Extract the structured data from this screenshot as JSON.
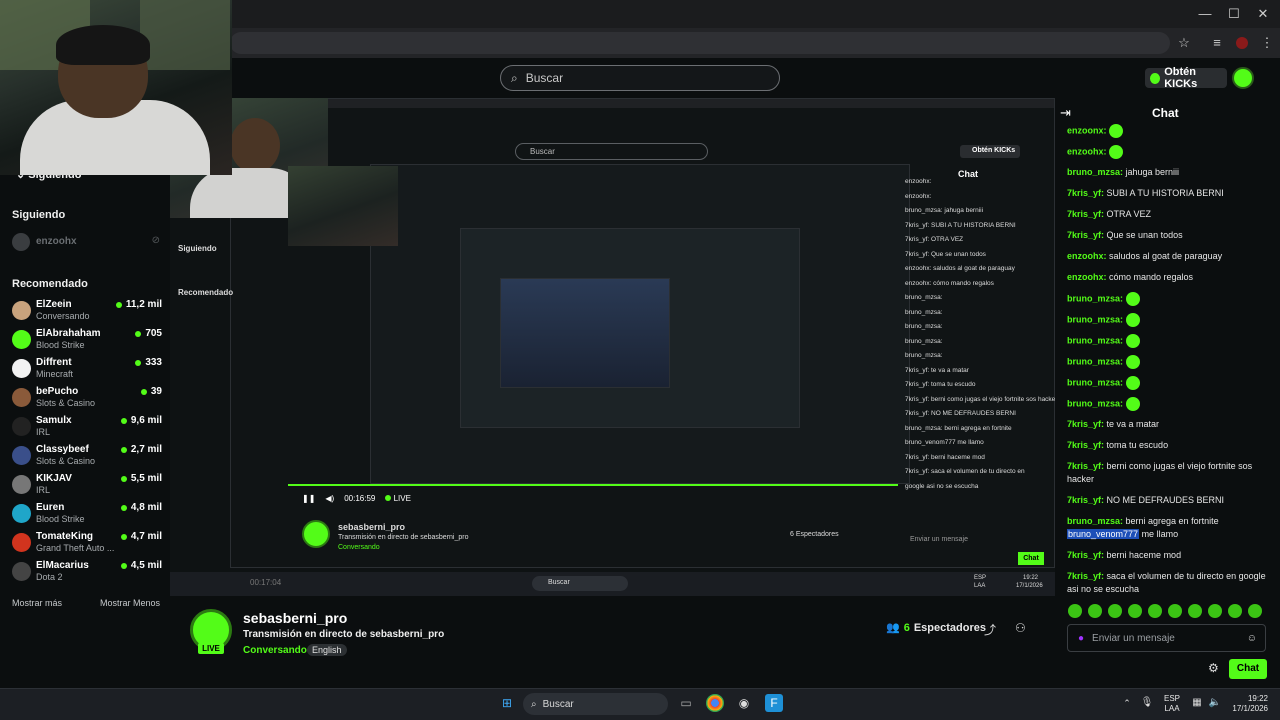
{
  "browser": {
    "window_controls": [
      "—",
      "☐",
      "✕"
    ],
    "toolbar_icons": [
      "star-icon",
      "reading-list-icon",
      "profile-icon",
      "menu-icon"
    ]
  },
  "header": {
    "search_placeholder": "Buscar",
    "kicks_label": "Obtén KICKs"
  },
  "sidebar": {
    "following_top": "Siguiendo",
    "following_label": "Siguiendo",
    "followed_channel": "enzoohx",
    "recommended_label": "Recomendado",
    "items": [
      {
        "name": "ElZeein",
        "category": "Conversando",
        "viewers": "11,2 mil",
        "color": "#c9a37d"
      },
      {
        "name": "ElAbrahaham",
        "category": "Blood Strike",
        "viewers": "705",
        "color": "#53fc18"
      },
      {
        "name": "Diffrent",
        "category": "Minecraft",
        "viewers": "333",
        "color": "#f2f2f2"
      },
      {
        "name": "bePucho",
        "category": "Slots & Casino",
        "viewers": "39",
        "color": "#8a5a3a"
      },
      {
        "name": "Samulx",
        "category": "IRL",
        "viewers": "9,6 mil",
        "color": "#222222"
      },
      {
        "name": "Classybeef",
        "category": "Slots & Casino",
        "viewers": "2,7 mil",
        "color": "#3a4f8a"
      },
      {
        "name": "KIKJAV",
        "category": "IRL",
        "viewers": "5,5 mil",
        "color": "#777777"
      },
      {
        "name": "Euren",
        "category": "Blood Strike",
        "viewers": "4,8 mil",
        "color": "#1fa6c9"
      },
      {
        "name": "TomateKing",
        "category": "Grand Theft Auto ...",
        "viewers": "4,7 mil",
        "color": "#d1341e"
      },
      {
        "name": "ElMacarius",
        "category": "Dota 2",
        "viewers": "4,5 mil",
        "color": "#444444"
      }
    ],
    "show_more": "Mostrar más",
    "show_less": "Mostrar Menos"
  },
  "player": {
    "time": "00:16:59",
    "live": "LIVE",
    "inner_channel": "sebasberni_pro",
    "inner_title": "Transmisión en directo de sebasberni_pro",
    "inner_category": "Conversando",
    "inner_language": "English",
    "inner_viewers": "6 Espectadores",
    "inner_chat_title": "Chat",
    "inner_chat_placeholder": "Enviar un mensaje",
    "inner_chat_button": "Chat",
    "inner_time_2": "00:17:04",
    "inner_taskbar_search": "Buscar",
    "inner_clock": "19:22",
    "inner_date": "17/1/2026",
    "inner_lang": "ESP",
    "inner_lang2": "LAA",
    "inner_chat_lines": [
      "enzoohx:",
      "enzoohx:",
      "bruno_mzsa: jahuga berniii",
      "7kris_yf: SUBI A TU HISTORIA BERNI",
      "7kris_yf: OTRA VEZ",
      "7kris_yf: Que se unan todos",
      "enzoohx: saludos al goat de paraguay",
      "enzoohx: cómo mando regalos",
      "bruno_mzsa:",
      "bruno_mzsa:",
      "bruno_mzsa:",
      "bruno_mzsa:",
      "bruno_mzsa:",
      "7kris_yf: te va a matar",
      "7kris_yf: toma tu escudo",
      "7kris_yf: berni como jugas el viejo fortnite sos hacker",
      "7kris_yf: NO ME DEFRAUDES BERNI",
      "bruno_mzsa: berni agrega en fortnite",
      "bruno_venom777 me llamo",
      "7kris_yf: berni haceme mod",
      "7kris_yf: saca el volumen de tu directo en",
      "google asi no se escucha"
    ]
  },
  "stream": {
    "channel": "sebasberni_pro",
    "title": "Transmisión en directo de sebasberni_pro",
    "category": "Conversando",
    "language": "English",
    "live_badge": "LIVE",
    "viewers_count": "6",
    "viewers_label": "Espectadores"
  },
  "chat": {
    "title": "Chat",
    "messages": [
      {
        "user": "enzoonx:",
        "text": "",
        "emote": true
      },
      {
        "user": "enzoohx:",
        "text": "",
        "emote": true
      },
      {
        "user": "bruno_mzsa:",
        "text": " jahuga berniii",
        "emote": false
      },
      {
        "user": "7kris_yf:",
        "text": " SUBI A TU HISTORIA BERNI",
        "emote": false
      },
      {
        "user": "7kris_yf:",
        "text": " OTRA VEZ",
        "emote": false
      },
      {
        "user": "7kris_yf:",
        "text": " Que se unan todos",
        "emote": false
      },
      {
        "user": "enzoohx:",
        "text": " saludos al goat de paraguay",
        "emote": false
      },
      {
        "user": "enzoohx:",
        "text": " cómo mando regalos",
        "emote": false
      },
      {
        "user": "bruno_mzsa:",
        "text": "",
        "emote": true
      },
      {
        "user": "bruno_mzsa:",
        "text": "",
        "emote": true
      },
      {
        "user": "bruno_mzsa:",
        "text": "",
        "emote": true
      },
      {
        "user": "bruno_mzsa:",
        "text": "",
        "emote": true
      },
      {
        "user": "bruno_mzsa:",
        "text": "",
        "emote": true
      },
      {
        "user": "bruno_mzsa:",
        "text": "",
        "emote": true
      },
      {
        "user": "7kris_yf:",
        "text": " te va a matar",
        "emote": false
      },
      {
        "user": "7kris_yf:",
        "text": " toma tu escudo",
        "emote": false
      },
      {
        "user": "7kris_yf:",
        "text": " berni como jugas el viejo fortnite sos hacker",
        "emote": false
      },
      {
        "user": "7kris_yf:",
        "text": " NO ME DEFRAUDES BERNI",
        "emote": false
      },
      {
        "user": "bruno_mzsa:",
        "text": " berni agrega en fortnite",
        "emote": false,
        "mention": "bruno_venom777",
        "after": " me llamo"
      },
      {
        "user": "7kris_yf:",
        "text": " berni haceme mod",
        "emote": false
      },
      {
        "user": "7kris_yf:",
        "text": " saca el volumen de tu directo en google asi no se escucha",
        "emote": false
      }
    ],
    "input_placeholder": "Enviar un mensaje",
    "send_button": "Chat"
  },
  "taskbar": {
    "search_label": "Buscar",
    "lang": "ESP",
    "lang2": "LAA",
    "time": "19:22",
    "date": "17/1/2026"
  },
  "colors": {
    "accent": "#53fc18",
    "background": "#0b0e0f"
  }
}
